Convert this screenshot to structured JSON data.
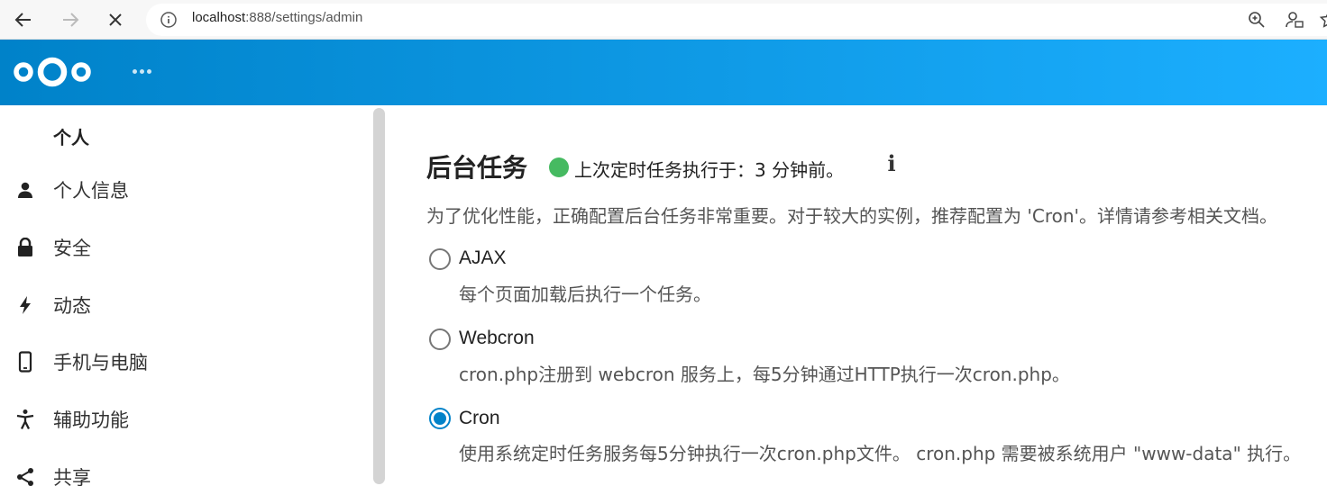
{
  "browser": {
    "url_host": "localhost",
    "url_path": ":888/settings/admin",
    "icons": [
      "back-icon",
      "forward-icon",
      "stop-icon",
      "info-circle-icon",
      "zoom-icon",
      "account-icon",
      "favorite-icon"
    ]
  },
  "header": {
    "logo": "nextcloud-logo",
    "app_menu": "more-apps-icon"
  },
  "sidebar": {
    "section_title": "个人",
    "items": [
      {
        "label": "个人信息",
        "icon": "user-icon"
      },
      {
        "label": "安全",
        "icon": "lock-icon"
      },
      {
        "label": "动态",
        "icon": "lightning-icon"
      },
      {
        "label": "手机与电脑",
        "icon": "phone-icon"
      },
      {
        "label": "辅助功能",
        "icon": "accessibility-icon"
      },
      {
        "label": "共享",
        "icon": "share-icon"
      }
    ]
  },
  "main": {
    "title": "后台任务",
    "status_text": "上次定时任务执行于：3 分钟前。",
    "status_color": "#46ba61",
    "description": "为了优化性能，正确配置后台任务非常重要。对于较大的实例，推荐配置为 'Cron'。详情请参考相关文档。",
    "options": [
      {
        "label": "AJAX",
        "hint": "每个页面加载后执行一个任务。",
        "checked": false
      },
      {
        "label": "Webcron",
        "hint": "cron.php注册到 webcron 服务上，每5分钟通过HTTP执行一次cron.php。",
        "checked": false
      },
      {
        "label": "Cron",
        "hint": "使用系统定时任务服务每5分钟执行一次cron.php文件。 cron.php 需要被系统用户 \"www-data\" 执行。",
        "checked": true
      }
    ]
  },
  "colors": {
    "accent": "#0082c9",
    "header_gradient_end": "#1cafff"
  }
}
